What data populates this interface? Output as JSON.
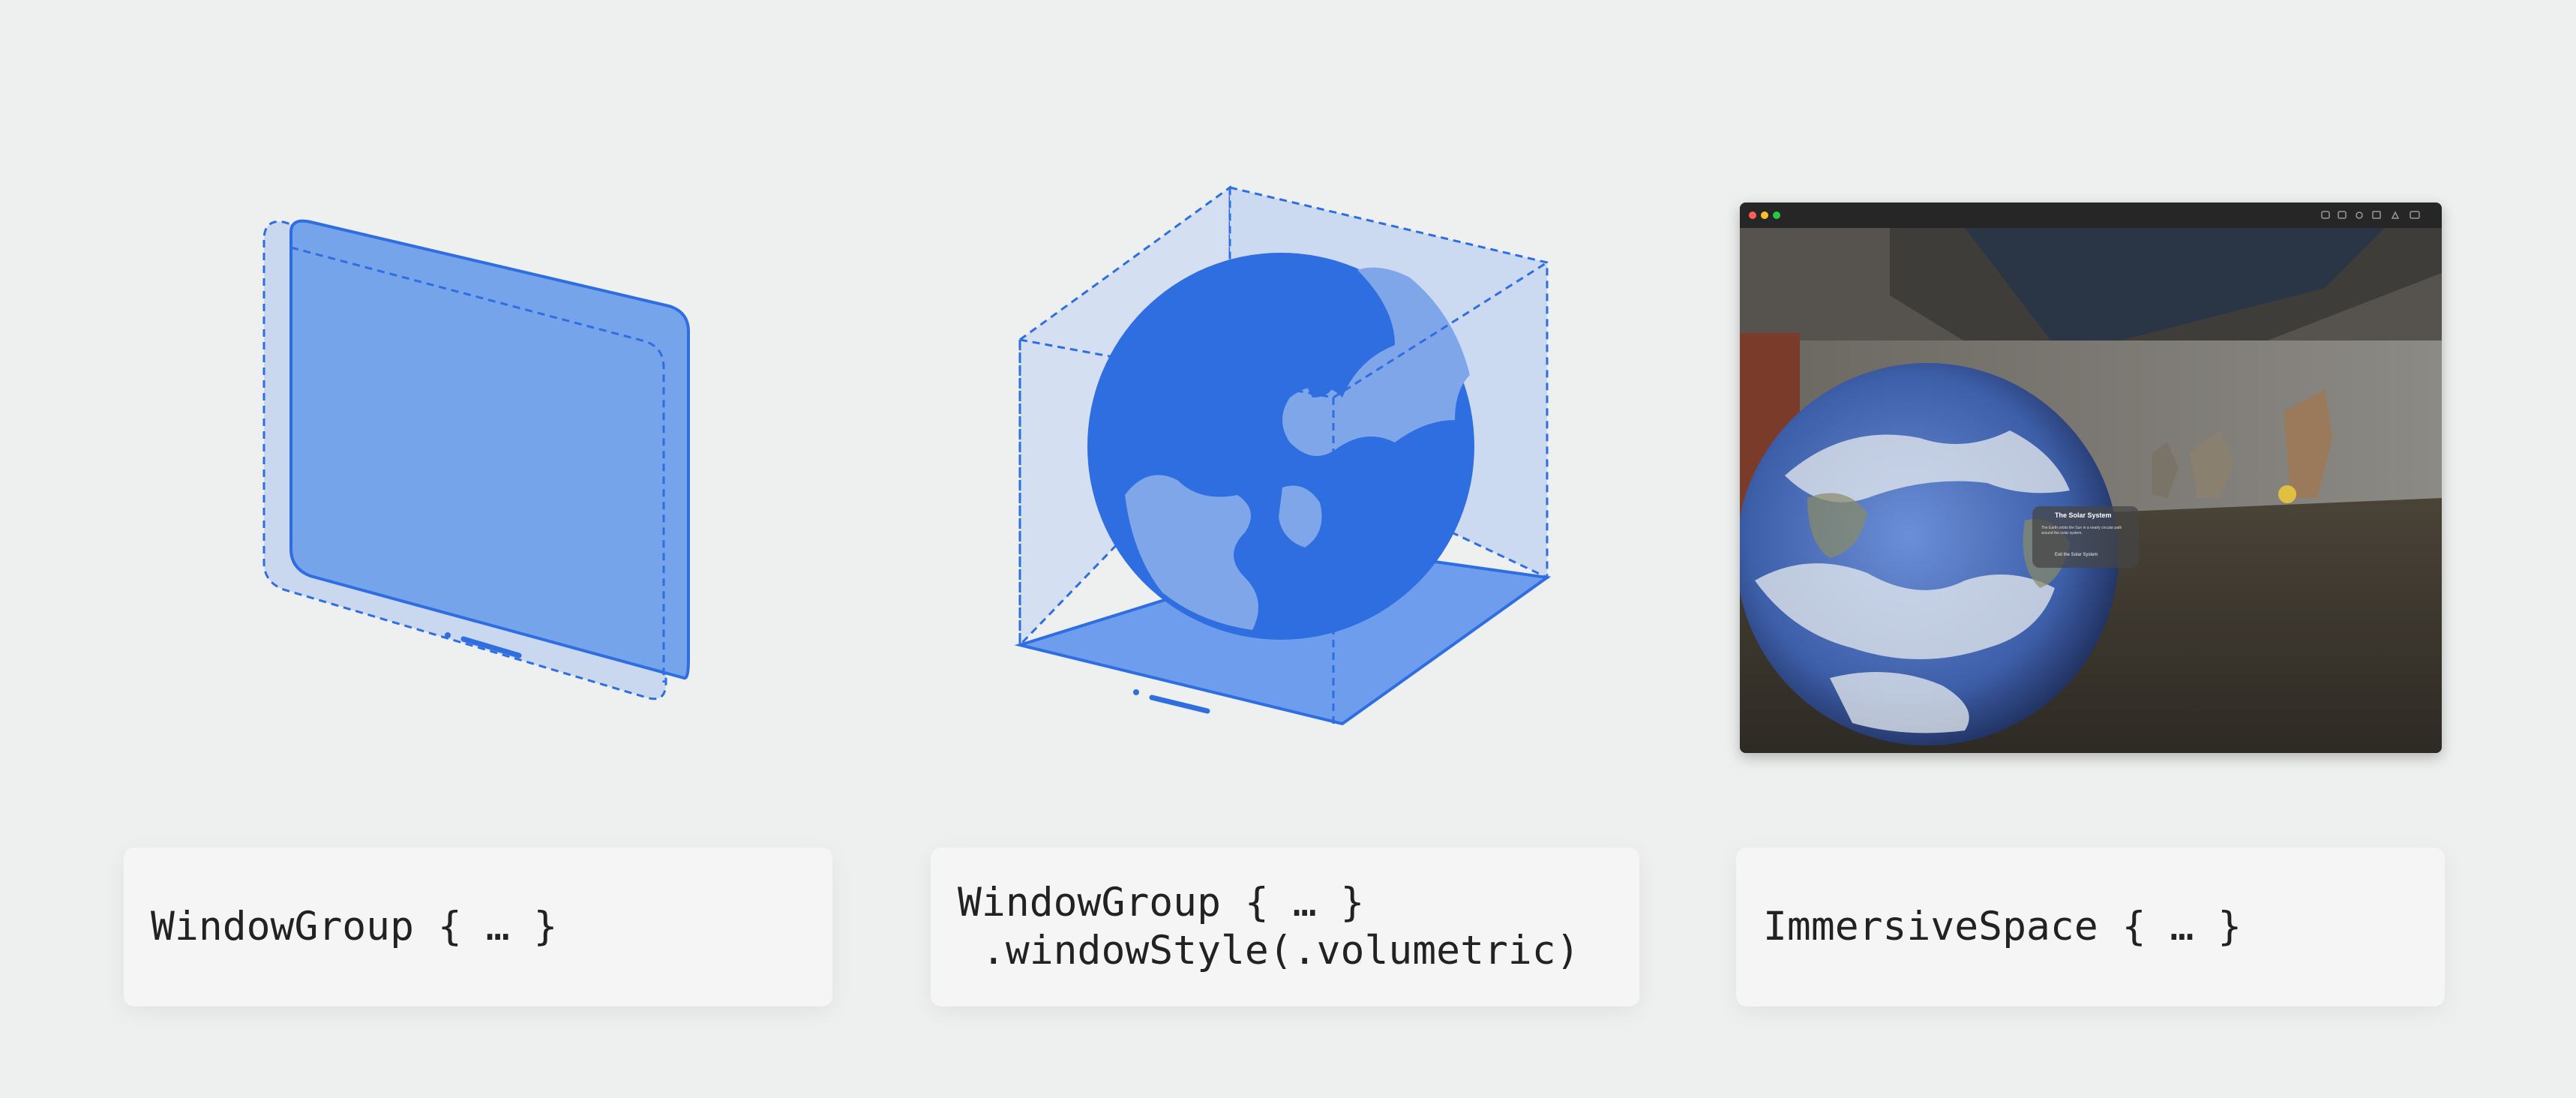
{
  "colors": {
    "background": "#eef0ef",
    "accent_blue": "#2f6ee0",
    "light_blue_fill": "#78a6ea",
    "card_background": "#f5f5f5"
  },
  "cards": [
    {
      "code_lines": [
        "WindowGroup { … }"
      ]
    },
    {
      "code_lines": [
        "WindowGroup { … }",
        " .windowStyle(.volumetric)"
      ]
    },
    {
      "code_lines": [
        "ImmersiveSpace { … }"
      ]
    }
  ],
  "illustrations": {
    "window": {
      "icon": "window-icon"
    },
    "volume": {
      "icon": "globe-icon"
    }
  },
  "immersive_screenshot": {
    "panel_title": "The Solar System",
    "panel_description": "The Earth orbits the Sun in a nearly circular path around the solar system.",
    "panel_action": "Exit the Solar System"
  }
}
